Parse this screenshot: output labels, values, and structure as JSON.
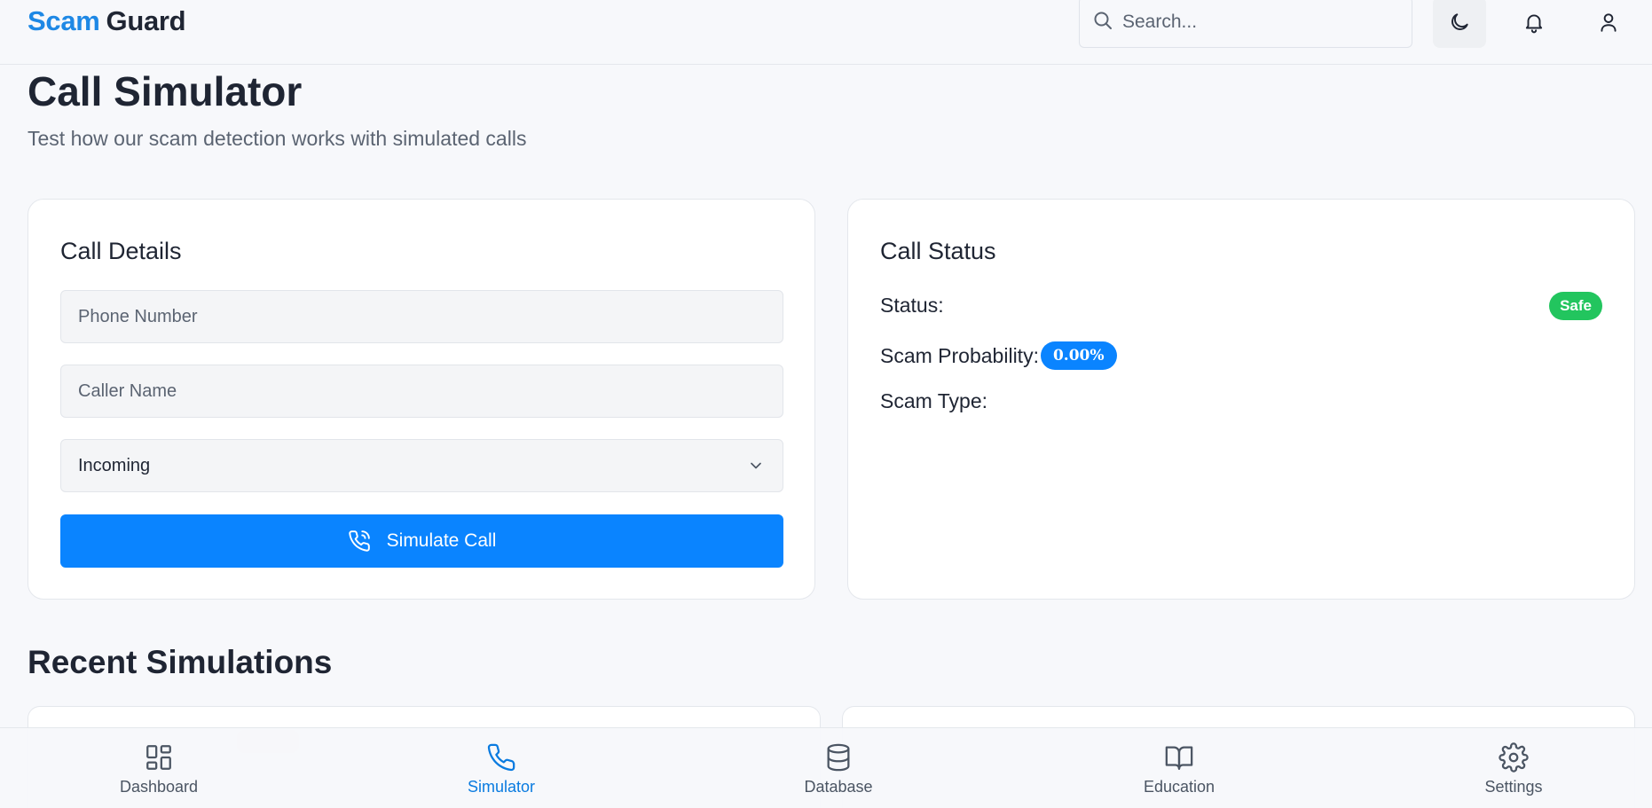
{
  "header": {
    "brand_part1": "Scam",
    "brand_part2": "Guard",
    "search_placeholder": "Search...",
    "icons": [
      "search-icon",
      "moon-icon",
      "bell-icon",
      "user-icon"
    ]
  },
  "page": {
    "title": "Call Simulator",
    "subtitle": "Test how our scam detection works with simulated calls"
  },
  "call_details": {
    "title": "Call Details",
    "phone_placeholder": "Phone Number",
    "phone_value": "",
    "caller_placeholder": "Caller Name",
    "caller_value": "",
    "direction_selected": "Incoming",
    "simulate_label": "Simulate Call"
  },
  "call_status": {
    "title": "Call Status",
    "status_label": "Status:",
    "status_value": "Safe",
    "probability_label": "Scam Probability:",
    "probability_value": "0.00%",
    "type_label": "Scam Type:",
    "type_value": ""
  },
  "recent": {
    "title": "Recent Simulations"
  },
  "nav": {
    "items": [
      {
        "label": "Dashboard",
        "icon": "grid-icon",
        "active": false
      },
      {
        "label": "Simulator",
        "icon": "phone-icon",
        "active": true
      },
      {
        "label": "Database",
        "icon": "database-icon",
        "active": false
      },
      {
        "label": "Education",
        "icon": "book-icon",
        "active": false
      },
      {
        "label": "Settings",
        "icon": "settings-icon",
        "active": false
      }
    ]
  },
  "colors": {
    "brand": "#1e88e5",
    "accent": "#0a84ff",
    "safe": "#22c55e",
    "active_nav": "#0a7be0"
  }
}
